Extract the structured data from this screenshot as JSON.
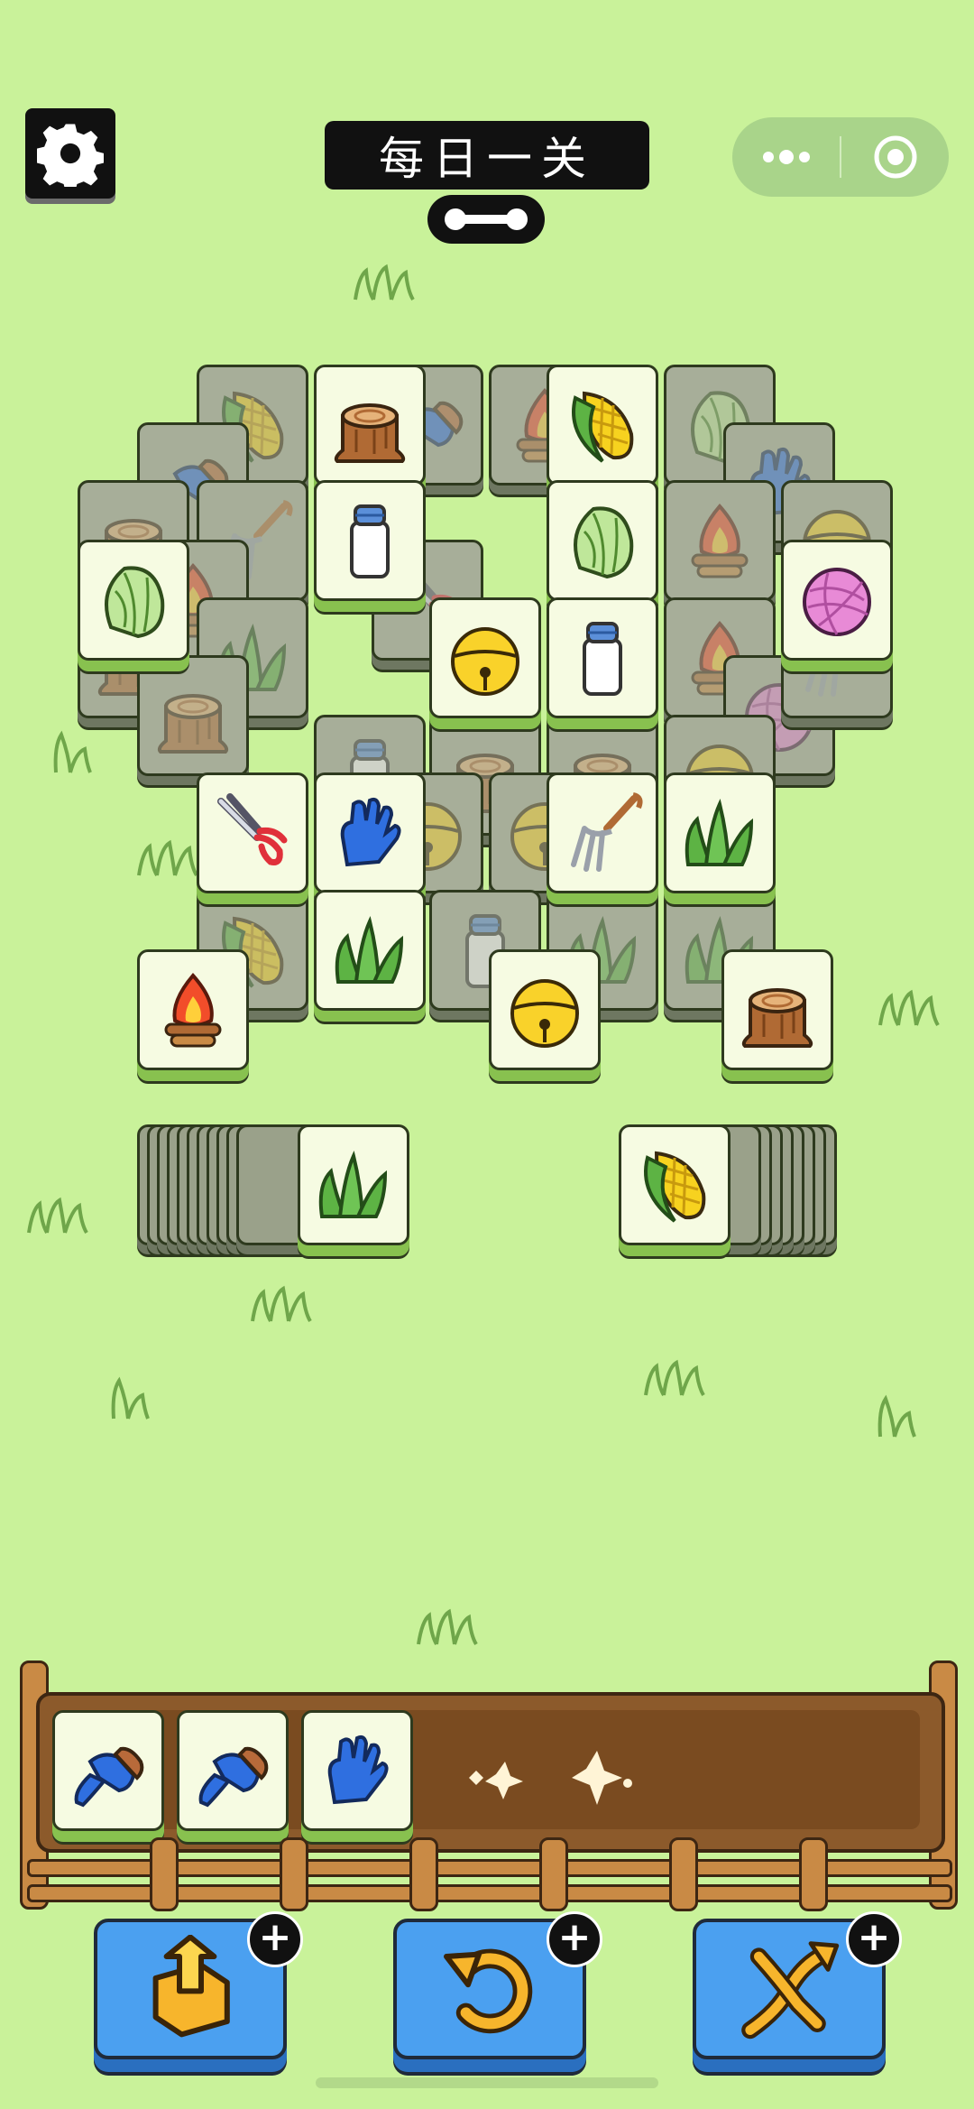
{
  "header": {
    "title": "每日一关"
  },
  "board": {
    "front_tiles": [
      {
        "item": "stump"
      },
      {
        "item": "corn"
      },
      {
        "item": "milk"
      },
      {
        "item": "cabbage"
      },
      {
        "item": "cabbage"
      },
      {
        "item": "yarn"
      },
      {
        "item": "bell"
      },
      {
        "item": "milk"
      },
      {
        "item": "shears"
      },
      {
        "item": "glove"
      },
      {
        "item": "pitchfork"
      },
      {
        "item": "grass"
      },
      {
        "item": "grass"
      },
      {
        "item": "campfire"
      },
      {
        "item": "bell"
      },
      {
        "item": "stump"
      }
    ],
    "left_stack_top": "grass",
    "right_stack_top": "corn"
  },
  "tray": {
    "slots": [
      {
        "item": "brush"
      },
      {
        "item": "brush"
      },
      {
        "item": "glove"
      }
    ]
  },
  "tools": [
    {
      "name": "move-out",
      "icon": "box-out-icon"
    },
    {
      "name": "undo",
      "icon": "undo-icon"
    },
    {
      "name": "shuffle",
      "icon": "shuffle-icon"
    }
  ],
  "colors": {
    "background": "#c9f29a",
    "tile_face": "#f6fbe2",
    "tile_side": "#88c14f",
    "button_blue": "#4ba0f0",
    "tray_wood": "#8c5a2b"
  }
}
